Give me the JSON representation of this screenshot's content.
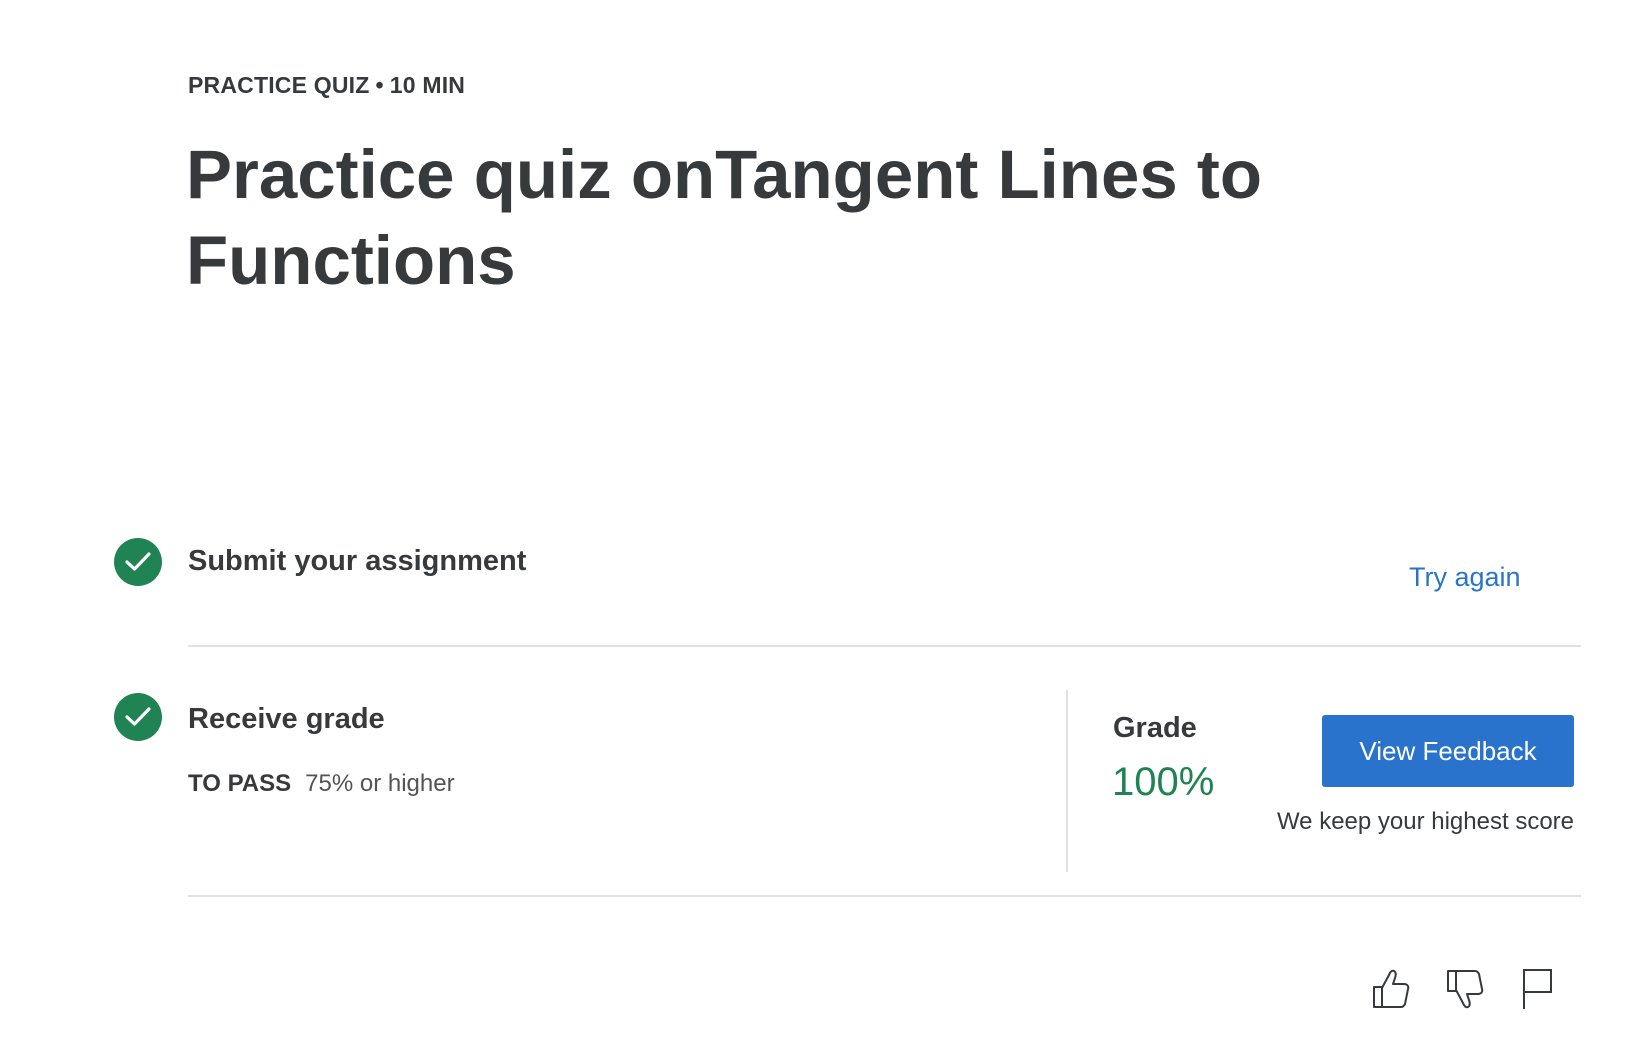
{
  "header": {
    "type_label": "PRACTICE QUIZ",
    "separator": "•",
    "duration": "10 MIN",
    "title": "Practice quiz onTangent Lines to Functions"
  },
  "steps": {
    "submit": {
      "title": "Submit your assignment",
      "action_label": "Try again",
      "status": "complete"
    },
    "receive": {
      "title": "Receive grade",
      "pass_label": "TO PASS",
      "pass_value": "75% or higher",
      "status": "complete"
    }
  },
  "grade": {
    "label": "Grade",
    "value": "100%",
    "button_label": "View Feedback",
    "note": "We keep your highest score"
  },
  "footer_actions": {
    "like_icon": "thumbs-up-icon",
    "dislike_icon": "thumbs-down-icon",
    "flag_icon": "flag-icon"
  },
  "colors": {
    "success": "#1f8354",
    "link": "#2a73cc",
    "text": "#373a3c",
    "divider": "#e1e1e1"
  }
}
